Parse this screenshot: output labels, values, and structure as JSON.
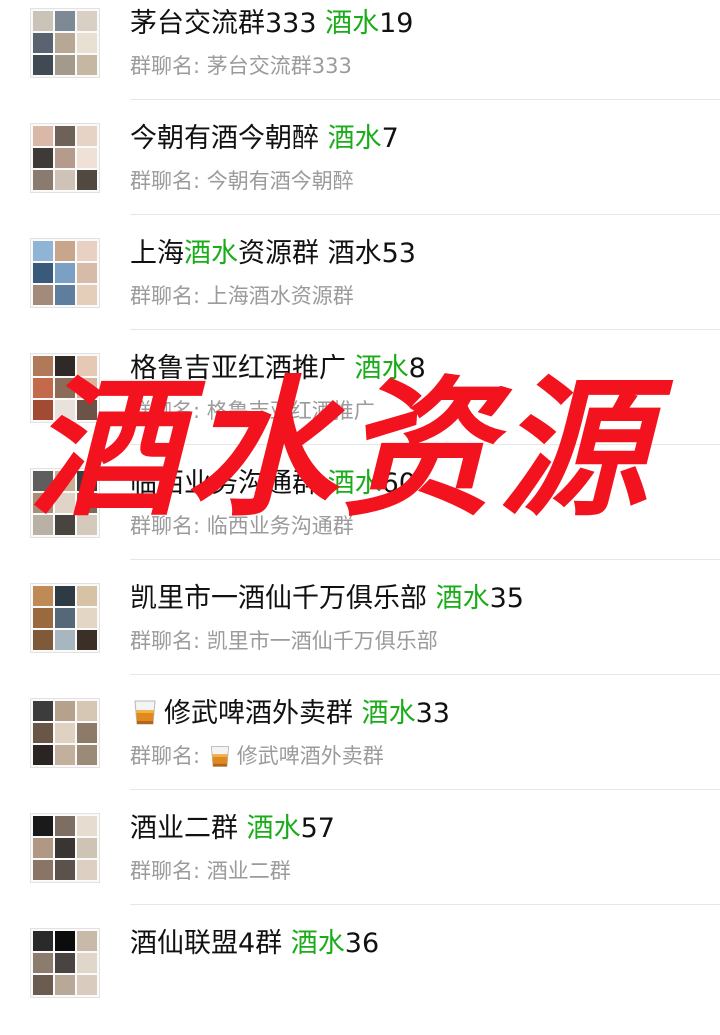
{
  "colors": {
    "highlight": "#1aad19",
    "overlay": "#f2131f",
    "subtext": "#9b9b9b"
  },
  "sub_prefix": "群聊名: ",
  "groups": [
    {
      "title_pre": "茅台交流群333 ",
      "title_hl": "酒水",
      "title_post": "19",
      "sub_name": "茅台交流群333"
    },
    {
      "title_pre": "今朝有酒今朝醉 ",
      "title_hl": "酒水",
      "title_post": "7",
      "sub_name": "今朝有酒今朝醉"
    },
    {
      "title_pre": "上海",
      "title_hl": "酒水",
      "title_post": "资源群 酒水53",
      "sub_name": "上海酒水资源群"
    },
    {
      "title_pre": "格鲁吉亚红酒推广 ",
      "title_hl": "酒水",
      "title_post": "8",
      "sub_name": "格鲁吉亚红酒推广"
    },
    {
      "title_pre": "临西业务沟通群 ",
      "title_hl": "酒水",
      "title_post": "60",
      "sub_name": "临西业务沟通群"
    },
    {
      "title_pre": "凯里市一酒仙千万俱乐部 ",
      "title_hl": "酒水",
      "title_post": "35",
      "sub_name": "凯里市一酒仙千万俱乐部"
    },
    {
      "title_pre": "修武啤酒外卖群 ",
      "title_hl": "酒水",
      "title_post": "33",
      "sub_name": "修武啤酒外卖群",
      "emoji": "whiskey-glass-icon"
    },
    {
      "title_pre": "酒业二群    ",
      "title_hl": "酒水",
      "title_post": "57",
      "sub_name": "酒业二群"
    },
    {
      "title_pre": "酒仙联盟4群 ",
      "title_hl": "酒水",
      "title_post": "36",
      "sub_name": ""
    }
  ],
  "overlay_text": "酒水资源"
}
